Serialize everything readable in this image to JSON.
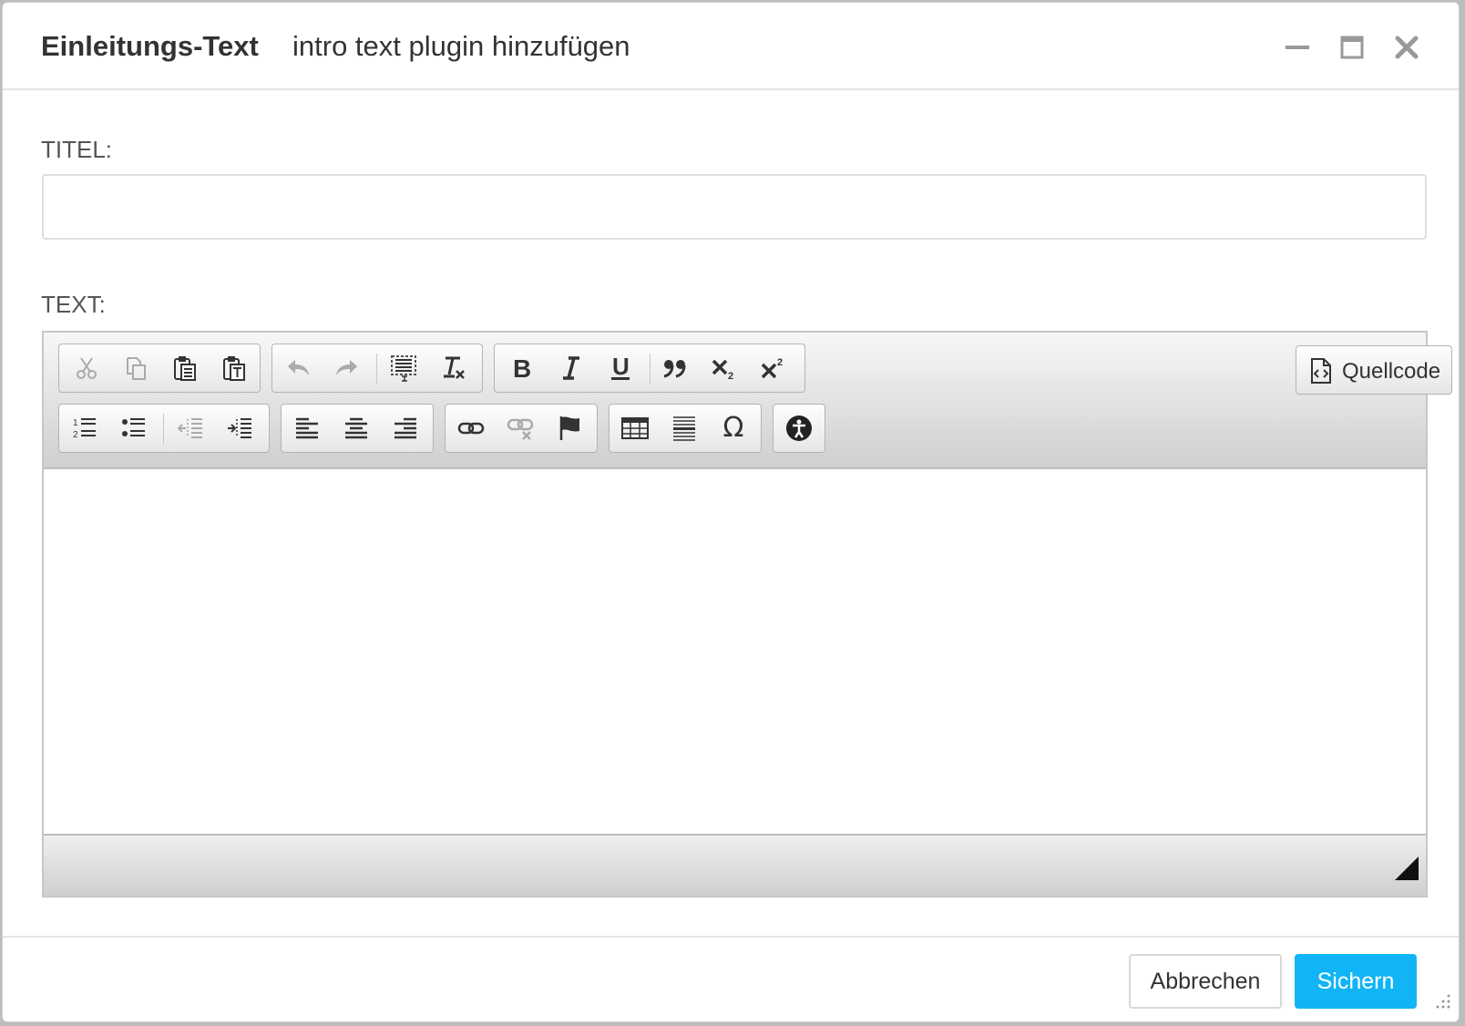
{
  "dialog": {
    "title": "Einleitungs-Text",
    "subtitle": "intro text plugin hinzufügen",
    "window_controls": [
      "minimize-icon",
      "maximize-icon",
      "close-icon"
    ]
  },
  "form": {
    "titel_label": "TITEL:",
    "titel_value": "",
    "text_label": "TEXT:"
  },
  "editor": {
    "toolbar_row1": [
      [
        "cut-icon",
        "copy-icon",
        "paste-icon",
        "paste-text-icon"
      ],
      [
        "undo-icon",
        "redo-icon",
        "select-all-icon",
        "remove-format-icon"
      ],
      [
        "bold-icon",
        "italic-icon",
        "underline-icon",
        "blockquote-icon",
        "subscript-icon",
        "superscript-icon"
      ]
    ],
    "toolbar_row2": [
      [
        "numbered-list-icon",
        "bulleted-list-icon",
        "outdent-icon",
        "indent-icon"
      ],
      [
        "align-left-icon",
        "align-center-icon",
        "align-right-icon"
      ],
      [
        "link-icon",
        "unlink-icon",
        "anchor-flag-icon"
      ],
      [
        "table-icon",
        "horizontal-rule-icon",
        "special-char-icon"
      ],
      [
        "accessibility-icon"
      ]
    ],
    "source_button": "Quellcode",
    "special_char_glyph": "Ω"
  },
  "footer": {
    "cancel_label": "Abbrechen",
    "save_label": "Sichern"
  },
  "colors": {
    "primary": "#11b5f5",
    "text": "#333333",
    "label": "#555555"
  }
}
